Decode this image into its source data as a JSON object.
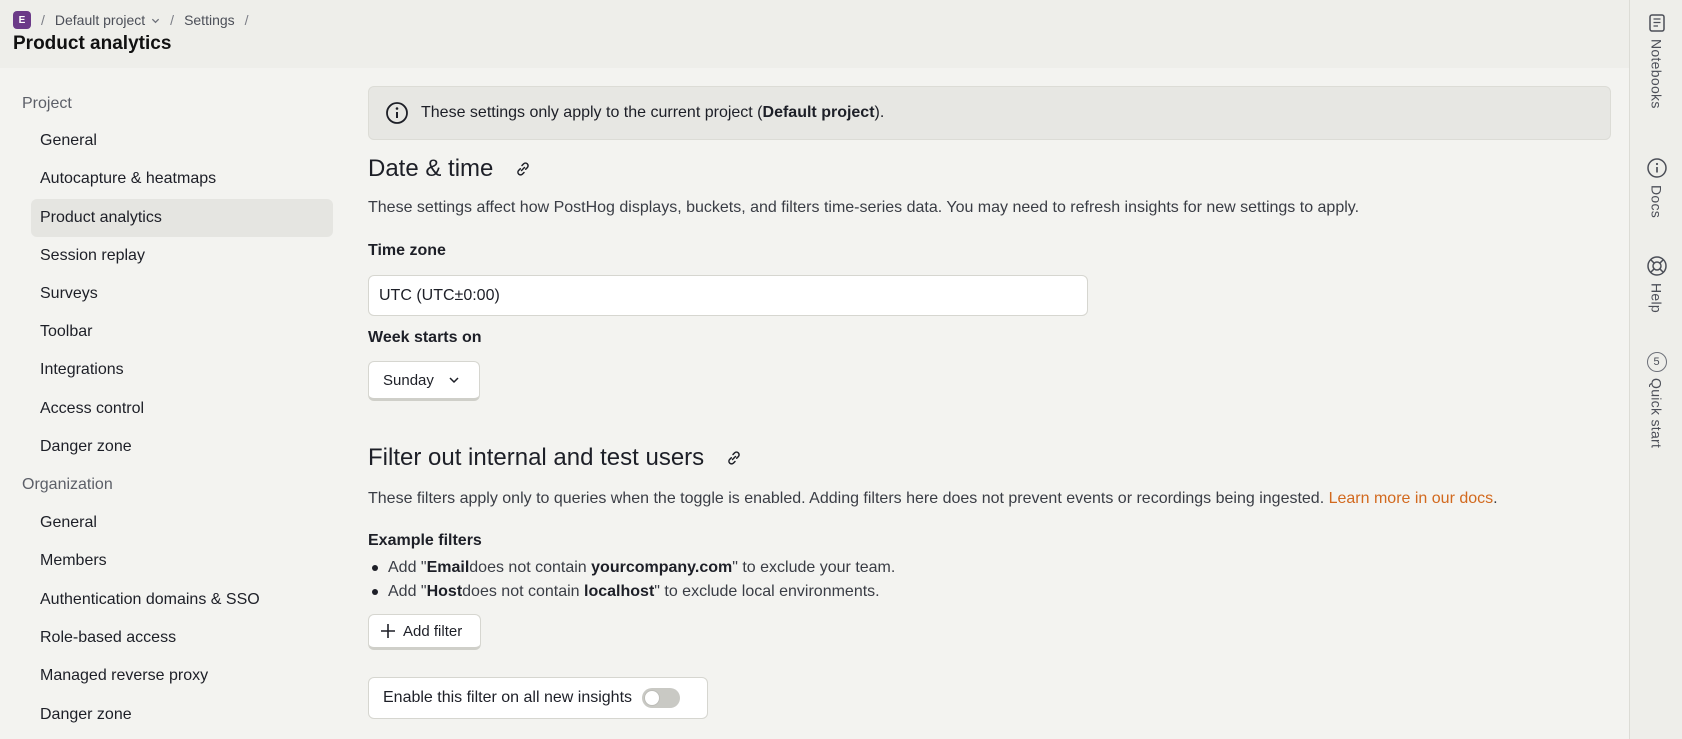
{
  "header": {
    "project_initial": "E",
    "project_name": "Default project",
    "settings_crumb": "Settings",
    "page_title": "Product analytics"
  },
  "nav": {
    "project_heading": "Project",
    "project_items": [
      "General",
      "Autocapture & heatmaps",
      "Product analytics",
      "Session replay",
      "Surveys",
      "Toolbar",
      "Integrations",
      "Access control",
      "Danger zone"
    ],
    "active_item": "Product analytics",
    "org_heading": "Organization",
    "org_items": [
      "General",
      "Members",
      "Authentication domains & SSO",
      "Role-based access",
      "Managed reverse proxy",
      "Danger zone"
    ]
  },
  "right_sidebar": {
    "items": [
      "Notebooks",
      "Docs",
      "Help",
      "Quick start"
    ],
    "quick_start_badge": "5"
  },
  "banner": {
    "text_before": "These settings only apply to the current project (",
    "project": "Default project",
    "text_after": ")."
  },
  "date_time": {
    "title": "Date & time",
    "description": "These settings affect how PostHog displays, buckets, and filters time-series data. You may need to refresh insights for new settings to apply.",
    "timezone_label": "Time zone",
    "timezone_value": "UTC (UTC±0:00)",
    "week_label": "Week starts on",
    "week_value": "Sunday"
  },
  "filters": {
    "title": "Filter out internal and test users",
    "description": "These filters apply only to queries when the toggle is enabled. Adding filters here does not prevent events or recordings being ingested.",
    "learn_more": "Learn more in our docs",
    "examples_label": "Example filters",
    "ex1": {
      "a": "Add \"",
      "b": "Email",
      "c": " does not contain ",
      "d": "yourcompany.com",
      "e": "\" to exclude your team."
    },
    "ex2": {
      "a": "Add \"",
      "b": "Host",
      "c": " does not contain ",
      "d": "localhost",
      "e": "\" to exclude local environments."
    },
    "add_filter": "Add filter",
    "toggle_label": "Enable this filter on all new insights",
    "toggle_on": false
  },
  "colors": {
    "accent_link": "#d2691e",
    "avatar": "#6b3a88"
  }
}
